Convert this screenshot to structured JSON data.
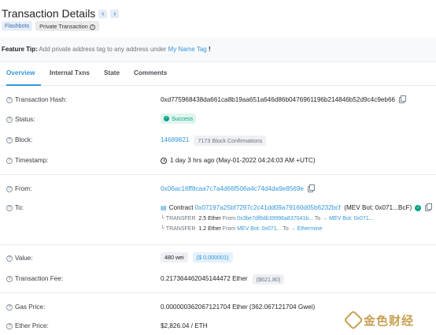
{
  "header": {
    "title": "Transaction Details",
    "prev_icon": "chevron-left-icon",
    "next_icon": "chevron-right-icon",
    "badges": [
      "Flashbots",
      "Private Transaction"
    ]
  },
  "feature_tip": {
    "label": "Feature Tip:",
    "text": "Add private address tag to any address under",
    "link": "My Name Tag",
    "suffix": "!"
  },
  "tabs": [
    "Overview",
    "Internal Txns",
    "State",
    "Comments"
  ],
  "fields": {
    "tx_hash": {
      "label": "Transaction Hash:",
      "value": "0xd775968438da661ca8b19aa651a646d86b0476961196b214846b52d9c4c9eb66"
    },
    "status": {
      "label": "Status:",
      "value": "Success"
    },
    "block": {
      "label": "Block:",
      "value": "14689821",
      "confirmations": "7173 Block Confirmations"
    },
    "timestamp": {
      "label": "Timestamp:",
      "value": "1 day 3 hrs ago (May-01-2022 04:24:03 AM +UTC)"
    },
    "from": {
      "label": "From:",
      "value": "0x06ac16ff8caa7c7a4d66f506a4c74d4da9e8569e"
    },
    "to": {
      "label": "To:",
      "prefix": "Contract",
      "address": "0x07197a25bf7297c2c41dd09a79160d05b6232bcf",
      "tag": "(MEV Bot: 0x071...BcF)"
    },
    "transfers": [
      {
        "kw": "TRANSFER",
        "amount": "2.5 Ether",
        "from_label": "From",
        "from": "0x3be7df8db39996a837041b...",
        "to_label": "To →",
        "to": "MEV Bot: 0x071..."
      },
      {
        "kw": "TRANSFER",
        "amount": "1.2 Ether",
        "from_label": "From",
        "from": "MEV Bot: 0x071...",
        "to_label": "To →",
        "to": "Ethermine"
      }
    ],
    "value": {
      "label": "Value:",
      "amount": "480 wei",
      "usd": "($ 0.000001)"
    },
    "fee": {
      "label": "Transaction Fee:",
      "amount": "0.217364462045144472 Ether",
      "usd": "($621.80)"
    },
    "gas_price": {
      "label": "Gas Price:",
      "value": "0.000000362067121704 Ether (362.067121704 Gwei)"
    },
    "ether_price": {
      "label": "Ether Price:",
      "value": "$2,826.04 / ETH"
    }
  },
  "watermark": {
    "text": "金色财经"
  },
  "colors": {
    "link": "#3498db",
    "success": "#00a186",
    "watermark": "#c8a052"
  }
}
